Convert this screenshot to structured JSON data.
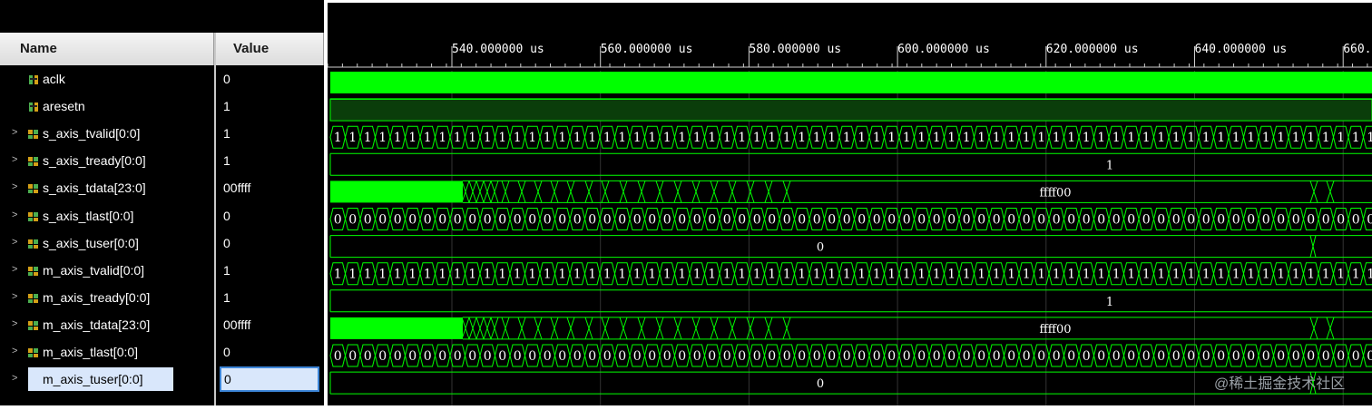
{
  "panel": {
    "name_header": "Name",
    "value_header": "Value"
  },
  "ruler": {
    "labels": [
      "540.000000 us",
      "560.000000 us",
      "580.000000 us",
      "600.000000 us",
      "620.000000 us",
      "640.000000 us",
      "660."
    ]
  },
  "signals": [
    {
      "name": "aclk",
      "value": "0",
      "expandable": false,
      "icon": "bit-signal-icon",
      "wave": "clock"
    },
    {
      "name": "aresetn",
      "value": "1",
      "expandable": false,
      "icon": "bit-signal-icon",
      "wave": "high"
    },
    {
      "name": "s_axis_tvalid[0:0]",
      "value": "1",
      "expandable": true,
      "icon": "bus-signal-icon",
      "wave": "repeat",
      "repeat_label": "1"
    },
    {
      "name": "s_axis_tready[0:0]",
      "value": "1",
      "expandable": true,
      "icon": "bus-signal-icon",
      "wave": "const",
      "const_label": "1"
    },
    {
      "name": "s_axis_tdata[23:0]",
      "value": "00ffff",
      "expandable": true,
      "icon": "bus-signal-icon",
      "wave": "data",
      "data_label": "ffff00"
    },
    {
      "name": "s_axis_tlast[0:0]",
      "value": "0",
      "expandable": true,
      "icon": "bus-signal-icon",
      "wave": "repeat",
      "repeat_label": "0"
    },
    {
      "name": "s_axis_tuser[0:0]",
      "value": "0",
      "expandable": true,
      "icon": "bus-signal-icon",
      "wave": "user",
      "const_label": "0"
    },
    {
      "name": "m_axis_tvalid[0:0]",
      "value": "1",
      "expandable": true,
      "icon": "bus-signal-icon",
      "wave": "repeat",
      "repeat_label": "1"
    },
    {
      "name": "m_axis_tready[0:0]",
      "value": "1",
      "expandable": true,
      "icon": "bus-signal-icon",
      "wave": "const",
      "const_label": "1"
    },
    {
      "name": "m_axis_tdata[23:0]",
      "value": "00ffff",
      "expandable": true,
      "icon": "bus-signal-icon",
      "wave": "data",
      "data_label": "ffff00"
    },
    {
      "name": "m_axis_tlast[0:0]",
      "value": "0",
      "expandable": true,
      "icon": "bus-signal-icon",
      "wave": "repeat",
      "repeat_label": "0"
    },
    {
      "name": "m_axis_tuser[0:0]",
      "value": "0",
      "expandable": true,
      "icon": "bus-signal-icon",
      "wave": "user",
      "const_label": "0",
      "selected": true
    }
  ],
  "watermark": "@稀土掘金技术社区",
  "colors": {
    "wave": "#00ff00",
    "wave_fill_dark": "#0a3d0a",
    "background": "#000000",
    "selection": "#d9e7fb",
    "selection_border": "#3d86d8"
  }
}
